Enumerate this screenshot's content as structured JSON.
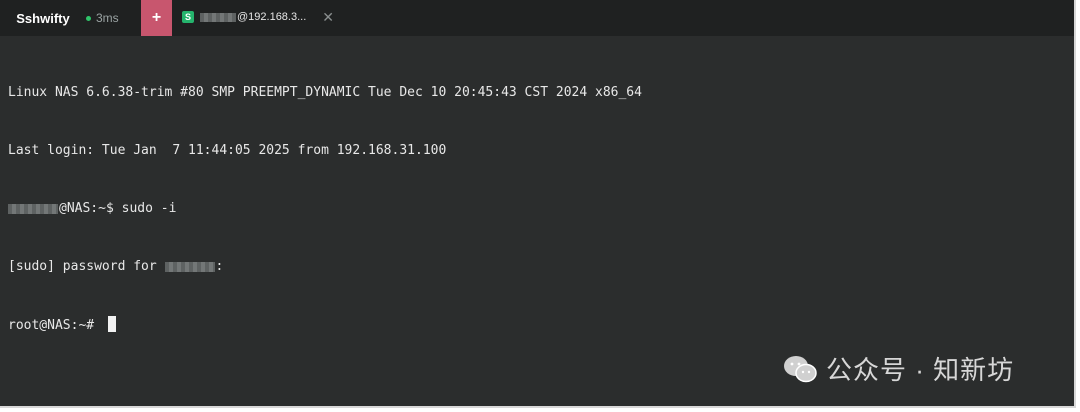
{
  "app": {
    "name": "Sshwifty",
    "latency": "3ms",
    "new_tab_symbol": "+"
  },
  "session_tab": {
    "badge": "S",
    "title_suffix": "@192.168.3...",
    "close_symbol": "✕"
  },
  "terminal": {
    "line1": "Linux NAS 6.6.38-trim #80 SMP PREEMPT_DYNAMIC Tue Dec 10 20:45:43 CST 2024 x86_64",
    "line2": "Last login: Tue Jan  7 11:44:05 2025 from 192.168.31.100",
    "line3_suffix": "@NAS:~$ sudo -i",
    "line4_prefix": "[sudo] password for ",
    "line4_suffix": ":",
    "line5": "root@NAS:~# "
  },
  "watermark": {
    "text": "公众号 · 知新坊"
  },
  "colors": {
    "terminal_bg": "#2b2d2d",
    "tabbar_bg": "#1f2121",
    "accent": "#c8566e",
    "status_green": "#2fc56a"
  }
}
